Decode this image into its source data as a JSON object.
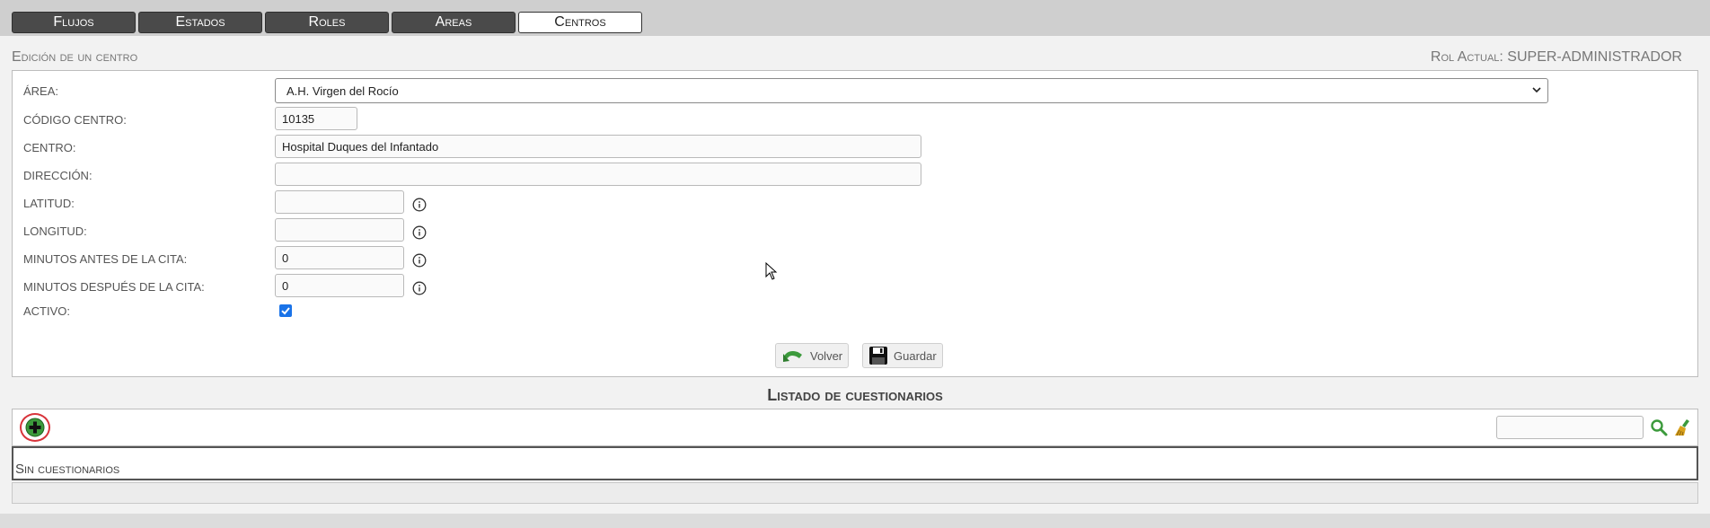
{
  "tabs": [
    {
      "label": "Flujos",
      "active": false
    },
    {
      "label": "Estados",
      "active": false
    },
    {
      "label": "Roles",
      "active": false
    },
    {
      "label": "Areas",
      "active": false
    },
    {
      "label": "Centros",
      "active": true
    }
  ],
  "header": {
    "section_title": "Edición de un centro",
    "role_text": "Rol Actual: SUPER-ADMINISTRADOR"
  },
  "form": {
    "area_label": "ÁREA:",
    "area_value": "A.H. Virgen del Rocío",
    "codigo_label": "CÓDIGO CENTRO:",
    "codigo_value": "10135",
    "centro_label": "CENTRO:",
    "centro_value": "Hospital Duques del Infantado",
    "direccion_label": "DIRECCIÓN:",
    "direccion_value": "",
    "latitud_label": "LATITUD:",
    "latitud_value": "",
    "longitud_label": "LONGITUD:",
    "longitud_value": "",
    "min_antes_label": "MINUTOS ANTES DE LA CITA:",
    "min_antes_value": "0",
    "min_despues_label": "MINUTOS DESPUÉS DE LA CITA:",
    "min_despues_value": "0",
    "activo_label": "ACTIVO:",
    "activo_checked": true
  },
  "buttons": {
    "volver": "Volver",
    "guardar": "Guardar"
  },
  "list": {
    "title": "Listado de cuestionarios",
    "search_value": "",
    "empty_text": "Sin cuestionarios"
  },
  "colors": {
    "accent_checkbox": "#1a73e8",
    "tab_dark": "#4a4a4a",
    "add_highlight": "#d8343b",
    "icon_green": "#3c9a3c"
  }
}
